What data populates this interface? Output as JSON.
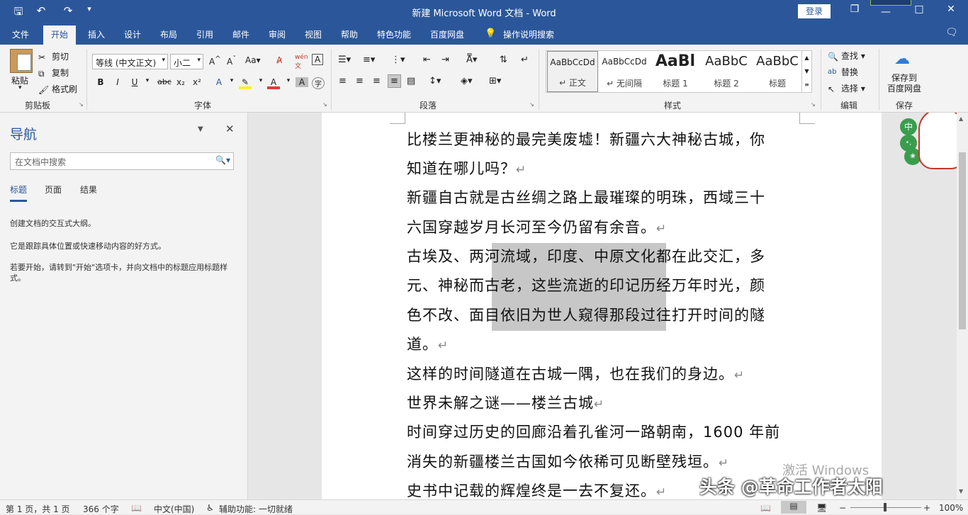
{
  "qat": {
    "save": "🖫",
    "undo": "↶",
    "redo": "↷",
    "more": "▾"
  },
  "title": "新建 Microsoft Word 文档  -  Word",
  "login": "登录",
  "window": {
    "restore": "❐",
    "minimize": "—",
    "maximize": "□",
    "close": "✕"
  },
  "tabs": [
    "文件",
    "开始",
    "插入",
    "设计",
    "布局",
    "引用",
    "邮件",
    "审阅",
    "视图",
    "帮助",
    "特色功能",
    "百度网盘"
  ],
  "tell_me": "操作说明搜索",
  "clipboard": {
    "paste": "粘贴",
    "cut": "剪切",
    "copy": "复制",
    "format_painter": "格式刷",
    "label": "剪贴板"
  },
  "font": {
    "name": "等线 (中文正文)",
    "size": "小二",
    "label": "字体"
  },
  "paragraph": {
    "label": "段落"
  },
  "styles": {
    "label": "样式",
    "items": [
      {
        "preview": "AaBbCcDd",
        "name": "↵ 正文"
      },
      {
        "preview": "AaBbCcDd",
        "name": "↵ 无间隔"
      },
      {
        "preview": "AaBl",
        "name": "标题 1"
      },
      {
        "preview": "AaBbC",
        "name": "标题 2"
      },
      {
        "preview": "AaBbC",
        "name": "标题"
      }
    ]
  },
  "editing": {
    "find": "查找",
    "replace": "替换",
    "select": "选择",
    "label": "编辑"
  },
  "save_group": {
    "button": "保存到\n百度网盘",
    "label": "保存"
  },
  "nav": {
    "title": "导航",
    "search_placeholder": "在文档中搜索",
    "tabs": [
      "标题",
      "页面",
      "结果"
    ],
    "text1": "创建文档的交互式大纲。",
    "text2": "它是跟踪具体位置或快速移动内容的好方式。",
    "text3": "若要开始，请转到\"开始\"选项卡，并向文档中的标题应用标题样式。"
  },
  "doc": {
    "lines": [
      "比楼兰更神秘的最完美废墟！新疆六大神秘古城，你",
      "知道在哪儿吗？",
      "新疆自古就是古丝绸之路上最璀璨的明珠，西域三十",
      "六国穿越岁月长河至今仍留有余音。",
      "古埃及、两河流域，印度、中原文化都在此交汇，多",
      "元、神秘而古老，这些流逝的印记历经万年时光，颜",
      "色不改、面目依旧为世人窥得那段过往打开时间的隧",
      "道。",
      "这样的时间隧道在古城一隅，也在我们的身边。",
      "世界未解之谜——楼兰古城",
      "时间穿过历史的回廊沿着孔雀河一路朝南，1600 年前",
      "消失的新疆楼兰古国如今依稀可见断壁残垣。",
      "史书中记载的辉煌终是一去不复还。"
    ],
    "para_mark": "↵"
  },
  "status": {
    "page": "第 1 页，共 1 页",
    "words": "366 个字",
    "lang": "中文(中国)",
    "access": "辅助功能: 一切就绪",
    "zoom": "100%"
  },
  "watermark": "激活 Windows",
  "overlay": "头条 @革命工作者太阳"
}
